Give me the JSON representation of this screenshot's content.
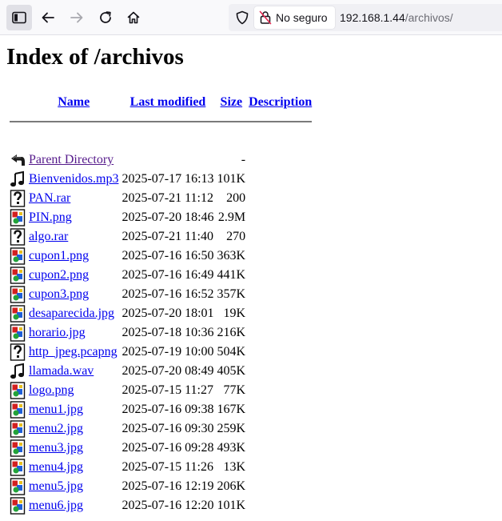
{
  "browser": {
    "security_label": "No seguro",
    "url_host": "192.168.1.44",
    "url_path": "/archivos/"
  },
  "page": {
    "title": "Index of /archivos"
  },
  "table": {
    "headers": {
      "name": "Name",
      "last_modified": "Last modified",
      "size": "Size",
      "description": "Description"
    },
    "parent": {
      "name": "Parent Directory",
      "size": "-",
      "icon": "back-icon"
    },
    "rows": [
      {
        "name": "Bienvenidos.mp3",
        "modified": "2025-07-17 16:13",
        "size": "101K",
        "icon": "sound-icon"
      },
      {
        "name": "PAN.rar",
        "modified": "2025-07-21 11:12",
        "size": "200",
        "icon": "unknown-icon"
      },
      {
        "name": "PIN.png",
        "modified": "2025-07-20 18:46",
        "size": "2.9M",
        "icon": "image-icon"
      },
      {
        "name": "algo.rar",
        "modified": "2025-07-21 11:40",
        "size": "270",
        "icon": "unknown-icon"
      },
      {
        "name": "cupon1.png",
        "modified": "2025-07-16 16:50",
        "size": "363K",
        "icon": "image-icon"
      },
      {
        "name": "cupon2.png",
        "modified": "2025-07-16 16:49",
        "size": "441K",
        "icon": "image-icon"
      },
      {
        "name": "cupon3.png",
        "modified": "2025-07-16 16:52",
        "size": "357K",
        "icon": "image-icon"
      },
      {
        "name": "desaparecida.jpg",
        "modified": "2025-07-20 18:01",
        "size": "19K",
        "icon": "image-icon"
      },
      {
        "name": "horario.jpg",
        "modified": "2025-07-18 10:36",
        "size": "216K",
        "icon": "image-icon"
      },
      {
        "name": "http_jpeg.pcapng",
        "modified": "2025-07-19 10:00",
        "size": "504K",
        "icon": "unknown-icon"
      },
      {
        "name": "llamada.wav",
        "modified": "2025-07-20 08:49",
        "size": "405K",
        "icon": "sound-icon"
      },
      {
        "name": "logo.png",
        "modified": "2025-07-15 11:27",
        "size": "77K",
        "icon": "image-icon"
      },
      {
        "name": "menu1.jpg",
        "modified": "2025-07-16 09:38",
        "size": "167K",
        "icon": "image-icon"
      },
      {
        "name": "menu2.jpg",
        "modified": "2025-07-16 09:30",
        "size": "259K",
        "icon": "image-icon"
      },
      {
        "name": "menu3.jpg",
        "modified": "2025-07-16 09:28",
        "size": "493K",
        "icon": "image-icon"
      },
      {
        "name": "menu4.jpg",
        "modified": "2025-07-15 11:26",
        "size": "13K",
        "icon": "image-icon"
      },
      {
        "name": "menu5.jpg",
        "modified": "2025-07-16 12:19",
        "size": "206K",
        "icon": "image-icon"
      },
      {
        "name": "menu6.jpg",
        "modified": "2025-07-16 12:20",
        "size": "101K",
        "icon": "image-icon"
      }
    ]
  }
}
